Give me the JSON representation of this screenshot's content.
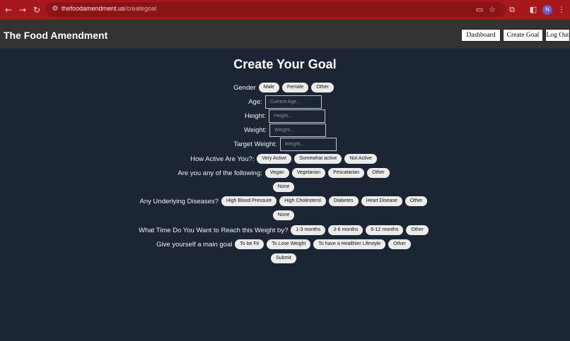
{
  "browser": {
    "url_domain": "thefoodamendment.us",
    "url_path": "/creategoal",
    "profile_initial": "N"
  },
  "header": {
    "brand": "The Food Amendment",
    "dashboard": "Dashboard",
    "create_goal": "Create Goal",
    "logout": "Log Out"
  },
  "page": {
    "title": "Create Your Goal",
    "gender": {
      "label": "Gender",
      "options": [
        "Male",
        "Female",
        "Other"
      ]
    },
    "age": {
      "label": "Age:",
      "placeholder": "Current Age..."
    },
    "height": {
      "label": "Height:",
      "placeholder": "Height..."
    },
    "weight": {
      "label": "Weight:",
      "placeholder": "Weight..."
    },
    "target_weight": {
      "label": "Target Weight:",
      "placeholder": "Weight..."
    },
    "activity": {
      "label": "How Active Are You?:",
      "options": [
        "Very Active",
        "Somewhat active",
        "Not Active"
      ]
    },
    "diet": {
      "label": "Are you any of the following:",
      "options": [
        "Vegan",
        "Vegetarian",
        "Pescatarian",
        "Other",
        "None"
      ]
    },
    "diseases": {
      "label": "Any Underlying Diseases?",
      "options": [
        "High Blood Pressure",
        "High Cholesterol",
        "Diabetes",
        "Heart Disease",
        "Other",
        "None"
      ]
    },
    "timeframe": {
      "label": "What Time Do You Want to Reach this Weight by?",
      "options": [
        "1-3 months",
        "3-6 months",
        "6-12 months",
        "Other"
      ]
    },
    "main_goal": {
      "label": "Give yourself a main goal",
      "options": [
        "To be Fit",
        "To Lose Weight",
        "To have a Healthier Lifestyle",
        "Other"
      ]
    },
    "submit": "Submit"
  }
}
